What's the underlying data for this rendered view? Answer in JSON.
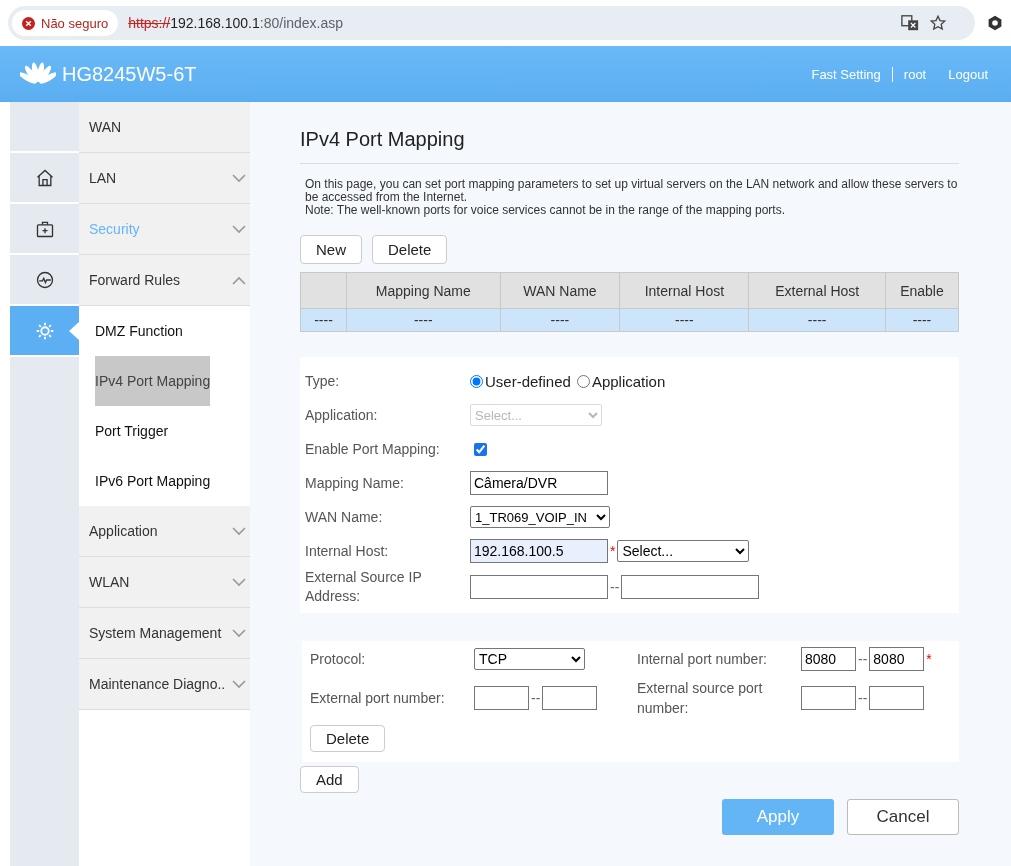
{
  "browser": {
    "security_badge": "Não seguro",
    "url": {
      "scheme": "https://",
      "host": "192.168.100.1",
      "rest": ":80/index.asp"
    }
  },
  "header": {
    "product": "HG8245W5-6T",
    "links": [
      {
        "label": "Fast Setting",
        "kind": "link"
      },
      {
        "label": "root",
        "kind": "user"
      },
      {
        "label": "Logout",
        "kind": "link"
      }
    ]
  },
  "icon_rail": [
    {
      "kind": "home",
      "selected": false
    },
    {
      "kind": "medkit",
      "selected": false
    },
    {
      "kind": "pulse",
      "selected": false
    },
    {
      "kind": "gear",
      "selected": true
    }
  ],
  "menu": [
    {
      "label": "WAN",
      "highlighted": false,
      "has_arrow": false
    },
    {
      "label": "LAN",
      "expanded": false,
      "highlighted": false,
      "has_arrow": true
    },
    {
      "label": "Security",
      "expanded": false,
      "highlighted": true,
      "has_arrow": true
    },
    {
      "label": "Forward Rules",
      "expanded": true,
      "highlighted": false,
      "has_arrow": true,
      "children": [
        {
          "label": "DMZ Function",
          "selected": false
        },
        {
          "label": "IPv4 Port Mapping",
          "selected": true
        },
        {
          "label": "Port Trigger",
          "selected": false
        },
        {
          "label": "IPv6 Port Mapping",
          "selected": false
        }
      ]
    },
    {
      "label": "Application",
      "expanded": false,
      "highlighted": false,
      "has_arrow": true
    },
    {
      "label": "WLAN",
      "expanded": false,
      "highlighted": false,
      "has_arrow": true
    },
    {
      "label": "System Management",
      "expanded": false,
      "highlighted": false,
      "has_arrow": true
    },
    {
      "label": "Maintenance Diagno..",
      "expanded": false,
      "highlighted": false,
      "has_arrow": true
    }
  ],
  "page": {
    "title": "IPv4 Port Mapping",
    "description": [
      "On this page, you can set port mapping parameters to set up virtual servers on the LAN network and allow these servers to be accessed from the Internet.",
      "Note: The well-known ports for voice services cannot be in the range of the mapping ports."
    ],
    "table_buttons": [
      "New",
      "Delete"
    ],
    "table": {
      "columns": [
        "",
        "Mapping Name",
        "WAN Name",
        "Internal Host",
        "External Host",
        "Enable"
      ],
      "rows": [
        [
          "----",
          "----",
          "----",
          "----",
          "----",
          "----"
        ]
      ]
    },
    "form": [
      {
        "label": "Type:",
        "kind": "radio",
        "options": [
          {
            "label": "User-defined",
            "selected": true
          },
          {
            "label": "Application",
            "selected": false
          }
        ]
      },
      {
        "label": "Application:",
        "kind": "select",
        "value": "Select...",
        "disabled": true
      },
      {
        "label": "Enable Port Mapping:",
        "kind": "checkbox",
        "checked": true
      },
      {
        "label": "Mapping Name:",
        "kind": "text",
        "value": "Câmera/DVR"
      },
      {
        "label": "WAN Name:",
        "kind": "select",
        "value": "1_TR069_VOIP_IN",
        "disabled": false
      },
      {
        "label": "Internal Host:",
        "kind": "host",
        "value": "192.168.100.5",
        "marker": "*",
        "select": "Select..."
      },
      {
        "label": "External Source IP Address:",
        "kind": "range",
        "separator": "--"
      }
    ],
    "ports": {
      "protocol": {
        "label": "Protocol:",
        "value": "TCP"
      },
      "internal_port": {
        "label": "Internal port number:",
        "from": "8080",
        "to": "8080",
        "separator": "--",
        "marker": "*"
      },
      "external_port": {
        "label": "External port number:",
        "separator": "--"
      },
      "external_source_port": {
        "label": "External source port number:",
        "separator": "--"
      },
      "delete_button": "Delete"
    },
    "add_button": "Add",
    "actions": [
      {
        "label": "Apply",
        "kind": "primary"
      },
      {
        "label": "Cancel",
        "kind": "secondary"
      }
    ]
  }
}
